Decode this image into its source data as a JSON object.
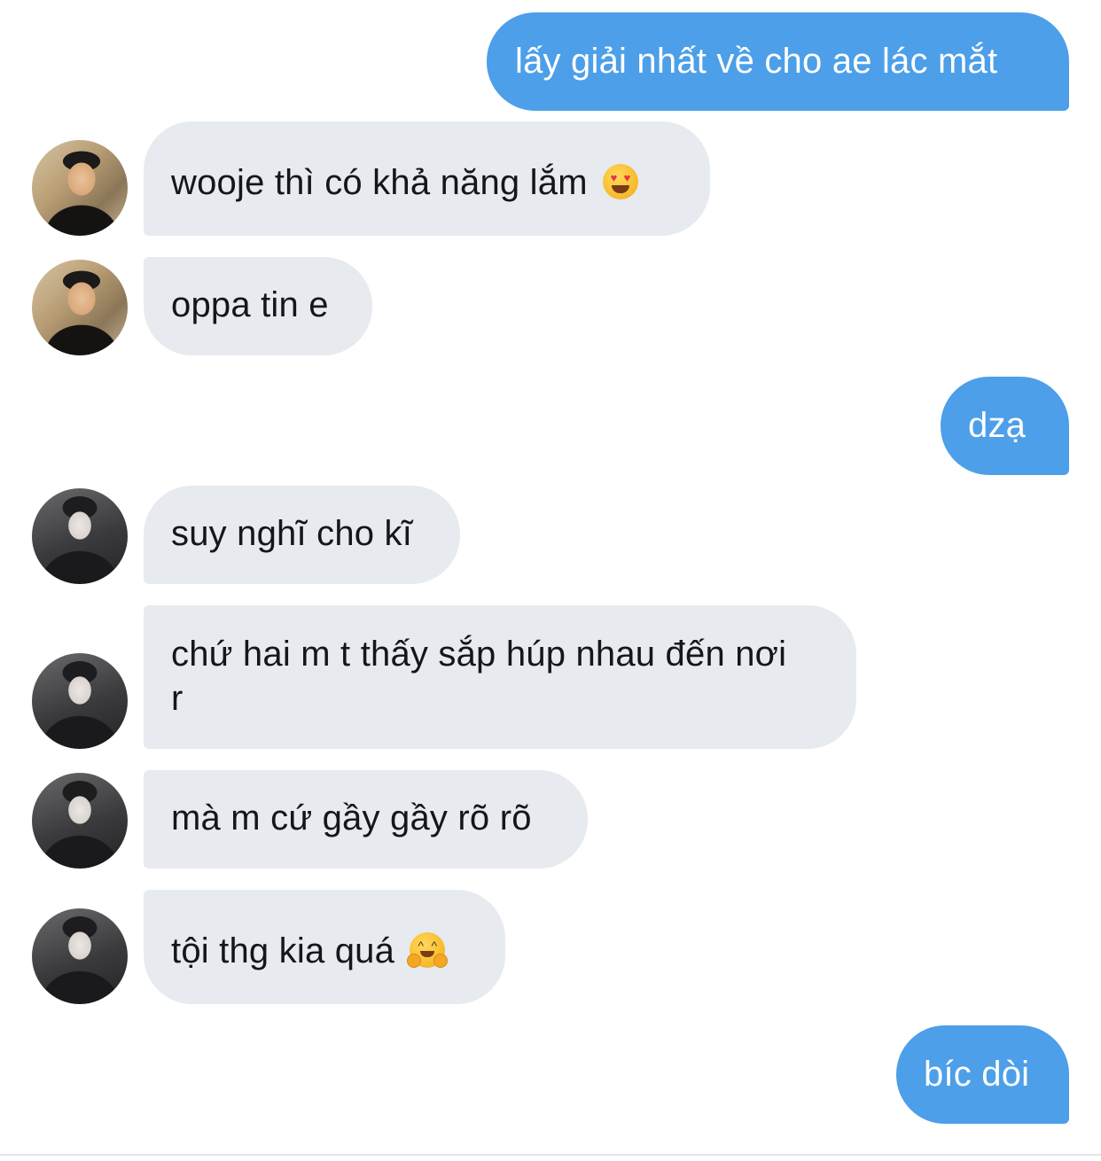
{
  "messages": [
    {
      "side": "sent",
      "text": "lấy giải nhất về cho ae lác mắt"
    },
    {
      "side": "received",
      "sender": "user-a",
      "text": "wooje thì có khả năng lắm",
      "emoji": "heart-eyes-emoji"
    },
    {
      "side": "received",
      "sender": "user-a",
      "text": "oppa tin e"
    },
    {
      "side": "sent",
      "text": "dzạ"
    },
    {
      "side": "received",
      "sender": "user-b",
      "text": "suy nghĩ cho kĩ"
    },
    {
      "side": "received",
      "sender": "user-b",
      "text": "chứ hai m t thấy sắp húp nhau đến nơi r"
    },
    {
      "side": "received",
      "sender": "user-b",
      "text": "mà m cứ gầy gầy rõ rõ"
    },
    {
      "side": "received",
      "sender": "user-b",
      "text": "tội thg kia quá",
      "emoji": "hugging-face-emoji"
    },
    {
      "side": "sent",
      "text": "bíc dòi"
    }
  ],
  "colors": {
    "sent_bubble": "#4c9fe8",
    "received_bubble": "#e7eaee",
    "sent_text": "#ffffff",
    "received_text": "#14171a",
    "background": "#ffffff"
  }
}
